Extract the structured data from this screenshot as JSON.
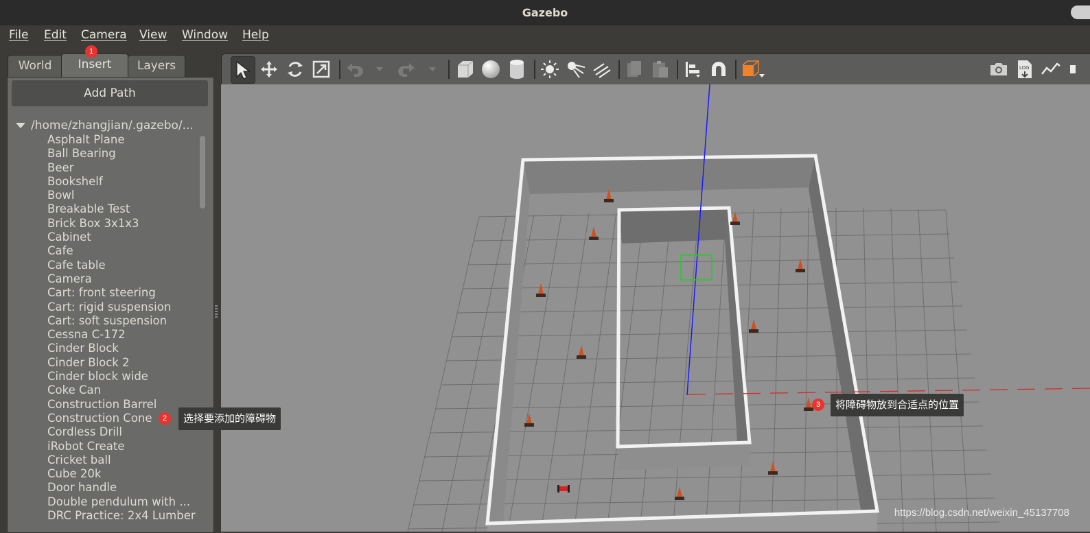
{
  "window": {
    "title": "Gazebo"
  },
  "menu": [
    "File",
    "Edit",
    "Camera",
    "View",
    "Window",
    "Help"
  ],
  "tabs": [
    {
      "label": "World",
      "active": false
    },
    {
      "label": "Insert",
      "active": true
    },
    {
      "label": "Layers",
      "active": false
    }
  ],
  "insert_panel": {
    "add_path_label": "Add Path",
    "root_path": "/home/zhangjian/.gazebo/...",
    "models": [
      "Asphalt Plane",
      "Ball Bearing",
      "Beer",
      "Bookshelf",
      "Bowl",
      "Breakable Test",
      "Brick Box 3x1x3",
      "Cabinet",
      "Cafe",
      "Cafe table",
      "Camera",
      "Cart: front steering",
      "Cart: rigid suspension",
      "Cart: soft suspension",
      "Cessna C-172",
      "Cinder Block",
      "Cinder Block 2",
      "Cinder block wide",
      "Coke Can",
      "Construction Barrel",
      "Construction Cone",
      "Cordless Drill",
      "iRobot Create",
      "Cricket ball",
      "Cube 20k",
      "Door handle",
      "Double pendulum with ...",
      "DRC Practice: 2x4 Lumber"
    ]
  },
  "toolbar": {
    "icons": [
      "select-arrow-icon",
      "translate-icon",
      "rotate-icon",
      "scale-icon",
      "undo-icon",
      "redo-icon",
      "box-icon",
      "sphere-icon",
      "cylinder-icon",
      "point-light-icon",
      "spot-light-icon",
      "directional-light-icon",
      "copy-icon",
      "paste-icon",
      "align-icon",
      "snap-icon",
      "view-angle-icon",
      "screenshot-icon",
      "log-icon",
      "plot-icon"
    ]
  },
  "annotations": [
    {
      "number": "1"
    },
    {
      "number": "2",
      "text": "选择要添加的障碍物"
    },
    {
      "number": "3",
      "text": "将障碍物放到合适点的位置"
    }
  ],
  "watermark": "https://blog.csdn.net/weixin_45137708",
  "colors": {
    "accent": "#f0822a",
    "badge": "#e8332f"
  }
}
